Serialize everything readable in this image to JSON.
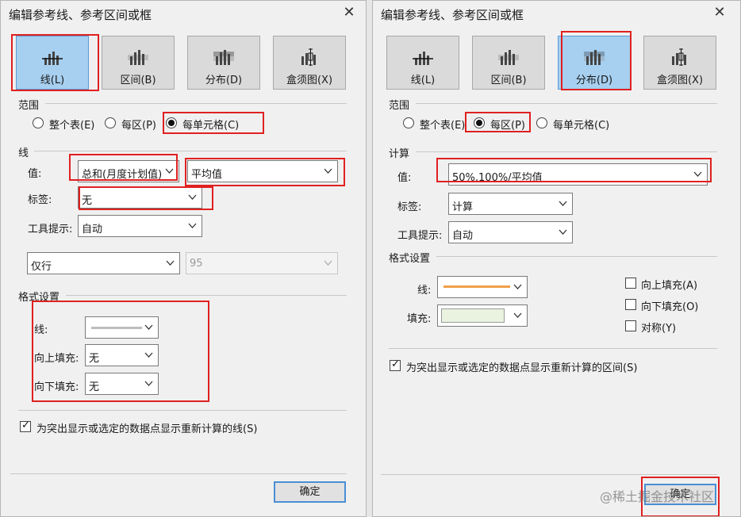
{
  "left": {
    "title": "编辑参考线、参考区间或框",
    "tabs": [
      {
        "label": "线(L)",
        "icon": "reference-line-icon",
        "selected": true
      },
      {
        "label": "区间(B)",
        "icon": "band-icon",
        "selected": false
      },
      {
        "label": "分布(D)",
        "icon": "distribution-icon",
        "selected": false
      },
      {
        "label": "盒须图(X)",
        "icon": "box-plot-icon",
        "selected": false
      }
    ],
    "scope": {
      "heading": "范围",
      "options": [
        "整个表(E)",
        "每区(P)",
        "每单元格(C)"
      ],
      "selected": "每单元格(C)"
    },
    "line": {
      "heading": "线",
      "value_label": "值:",
      "value_field": "总和(月度计划值)",
      "aggregation": "平均值",
      "label_label": "标签:",
      "label_value": "无",
      "tooltip_label": "工具提示:",
      "tooltip_value": "自动",
      "only_select": "仅行",
      "confidence_value": "95"
    },
    "format": {
      "heading": "格式设置",
      "line_label": "线:",
      "fill_above_label": "向上填充:",
      "fill_above_value": "无",
      "fill_below_label": "向下填充:",
      "fill_below_value": "无"
    },
    "recalc_label": "为突出显示或选定的数据点显示重新计算的线(S)",
    "recalc_checked": true,
    "ok_label": "确定"
  },
  "right": {
    "title": "编辑参考线、参考区间或框",
    "tabs": [
      {
        "label": "线(L)",
        "icon": "reference-line-icon",
        "selected": false
      },
      {
        "label": "区间(B)",
        "icon": "band-icon",
        "selected": false
      },
      {
        "label": "分布(D)",
        "icon": "distribution-icon",
        "selected": true
      },
      {
        "label": "盒须图(X)",
        "icon": "box-plot-icon",
        "selected": false
      }
    ],
    "scope": {
      "heading": "范围",
      "options": [
        "整个表(E)",
        "每区(P)",
        "每单元格(C)"
      ],
      "selected": "每区(P)"
    },
    "calc": {
      "heading": "计算",
      "value_label": "值:",
      "value_field": "50%,100%/平均值",
      "label_label": "标签:",
      "label_value": "计算",
      "tooltip_label": "工具提示:",
      "tooltip_value": "自动"
    },
    "format": {
      "heading": "格式设置",
      "line_label": "线:",
      "fill_label": "填充:",
      "line_color": "#f0a04a",
      "fill_color": "#eaf2e0",
      "fill_up_label": "向上填充(A)",
      "fill_down_label": "向下填充(O)",
      "symmetric_label": "对称(Y)"
    },
    "recalc_label": "为突出显示或选定的数据点显示重新计算的区间(S)",
    "recalc_checked": true,
    "ok_label": "确定"
  },
  "watermark": "@稀土掘金技术社区",
  "colors": {
    "highlight": "#e02020",
    "tab_selected": "#a6cff0",
    "button_border": "#4a8fd4"
  }
}
